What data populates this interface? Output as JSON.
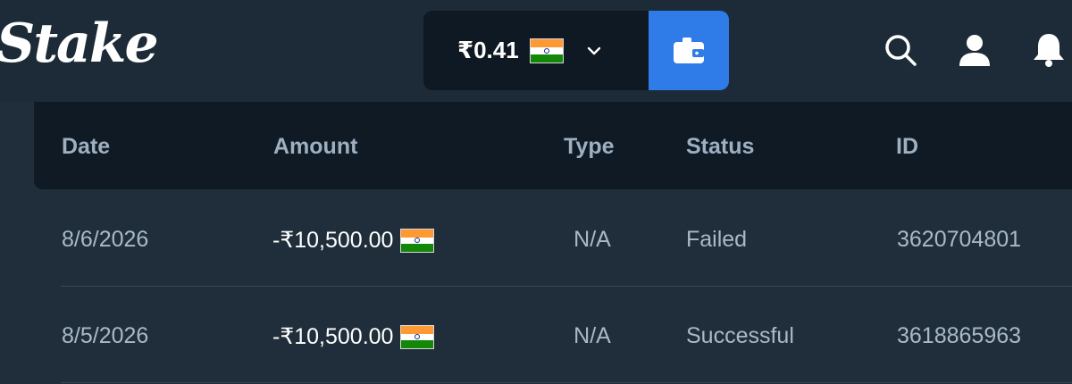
{
  "header": {
    "logo": "Stake",
    "balance": "₹0.41",
    "icons": {
      "balance_dropdown": "chevron-down-icon",
      "wallet": "wallet-icon",
      "search": "search-icon",
      "profile": "user-icon",
      "notifications": "bell-icon"
    }
  },
  "table": {
    "columns": [
      "Date",
      "Amount",
      "Type",
      "Status",
      "ID"
    ],
    "rows": [
      {
        "date": "8/6/2026",
        "amount": "-₹10,500.00",
        "type": "N/A",
        "status": "Failed",
        "id": "3620704801"
      },
      {
        "date": "8/5/2026",
        "amount": "-₹10,500.00",
        "type": "N/A",
        "status": "Successful",
        "id": "3618865963"
      }
    ]
  },
  "colors": {
    "accent": "#2f7be7",
    "header_bg": "#1c2b37",
    "table_head_bg": "#0f1a24",
    "page_bg": "#1f2e3a"
  }
}
